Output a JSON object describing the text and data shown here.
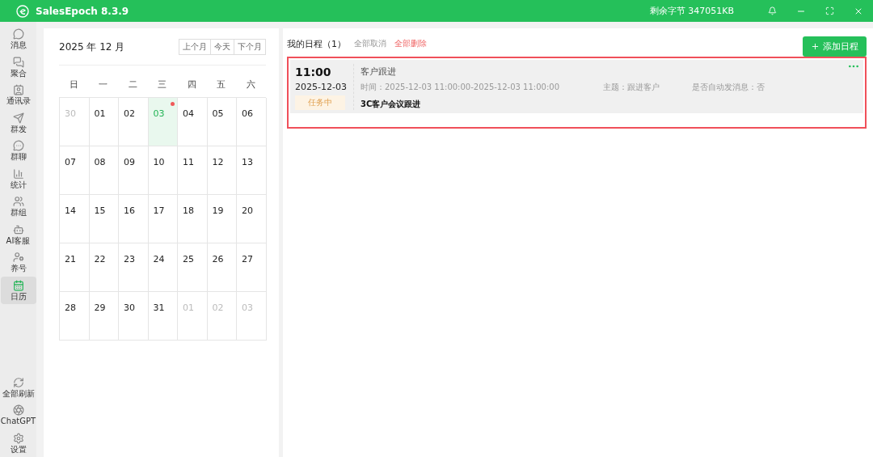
{
  "window": {
    "title": "SalesEpoch 8.3.9",
    "storage": "剩余字节 347051KB"
  },
  "sidebar": {
    "items": [
      {
        "label": "消息",
        "selected": false
      },
      {
        "label": "聚合",
        "selected": false
      },
      {
        "label": "通讯录",
        "selected": false
      },
      {
        "label": "群发",
        "selected": false
      },
      {
        "label": "群聊",
        "selected": false
      },
      {
        "label": "统计",
        "selected": false
      },
      {
        "label": "群组",
        "selected": false
      },
      {
        "label": "AI客服",
        "selected": false
      },
      {
        "label": "养号",
        "selected": false
      },
      {
        "label": "日历",
        "selected": true
      }
    ],
    "bottom_items": [
      {
        "label": "全部刷新"
      },
      {
        "label": "ChatGPT"
      },
      {
        "label": "设置"
      }
    ]
  },
  "calendar": {
    "month_label": "2025 年 12 月",
    "nav_buttons": [
      "上个月",
      "今天",
      "下个月"
    ],
    "weekdays": [
      "日",
      "一",
      "二",
      "三",
      "四",
      "五",
      "六"
    ],
    "weeks": [
      [
        {
          "day": "30",
          "muted": true,
          "selected": false,
          "has_event": false
        },
        {
          "day": "01",
          "muted": false,
          "selected": false,
          "has_event": false
        },
        {
          "day": "02",
          "muted": false,
          "selected": false,
          "has_event": false
        },
        {
          "day": "03",
          "muted": false,
          "selected": true,
          "has_event": true
        },
        {
          "day": "04",
          "muted": false,
          "selected": false,
          "has_event": false
        },
        {
          "day": "05",
          "muted": false,
          "selected": false,
          "has_event": false
        },
        {
          "day": "06",
          "muted": false,
          "selected": false,
          "has_event": false
        }
      ],
      [
        {
          "day": "07",
          "muted": false,
          "selected": false,
          "has_event": false
        },
        {
          "day": "08",
          "muted": false,
          "selected": false,
          "has_event": false
        },
        {
          "day": "09",
          "muted": false,
          "selected": false,
          "has_event": false
        },
        {
          "day": "10",
          "muted": false,
          "selected": false,
          "has_event": false
        },
        {
          "day": "11",
          "muted": false,
          "selected": false,
          "has_event": false
        },
        {
          "day": "12",
          "muted": false,
          "selected": false,
          "has_event": false
        },
        {
          "day": "13",
          "muted": false,
          "selected": false,
          "has_event": false
        }
      ],
      [
        {
          "day": "14",
          "muted": false,
          "selected": false,
          "has_event": false
        },
        {
          "day": "15",
          "muted": false,
          "selected": false,
          "has_event": false
        },
        {
          "day": "16",
          "muted": false,
          "selected": false,
          "has_event": false
        },
        {
          "day": "17",
          "muted": false,
          "selected": false,
          "has_event": false
        },
        {
          "day": "18",
          "muted": false,
          "selected": false,
          "has_event": false
        },
        {
          "day": "19",
          "muted": false,
          "selected": false,
          "has_event": false
        },
        {
          "day": "20",
          "muted": false,
          "selected": false,
          "has_event": false
        }
      ],
      [
        {
          "day": "21",
          "muted": false,
          "selected": false,
          "has_event": false
        },
        {
          "day": "22",
          "muted": false,
          "selected": false,
          "has_event": false
        },
        {
          "day": "23",
          "muted": false,
          "selected": false,
          "has_event": false
        },
        {
          "day": "24",
          "muted": false,
          "selected": false,
          "has_event": false
        },
        {
          "day": "25",
          "muted": false,
          "selected": false,
          "has_event": false
        },
        {
          "day": "26",
          "muted": false,
          "selected": false,
          "has_event": false
        },
        {
          "day": "27",
          "muted": false,
          "selected": false,
          "has_event": false
        }
      ],
      [
        {
          "day": "28",
          "muted": false,
          "selected": false,
          "has_event": false
        },
        {
          "day": "29",
          "muted": false,
          "selected": false,
          "has_event": false
        },
        {
          "day": "30",
          "muted": false,
          "selected": false,
          "has_event": false
        },
        {
          "day": "31",
          "muted": false,
          "selected": false,
          "has_event": false
        },
        {
          "day": "01",
          "muted": true,
          "selected": false,
          "has_event": false
        },
        {
          "day": "02",
          "muted": true,
          "selected": false,
          "has_event": false
        },
        {
          "day": "03",
          "muted": true,
          "selected": false,
          "has_event": false
        }
      ]
    ]
  },
  "schedule": {
    "title": "我的日程（1）",
    "cancel_all": "全部取消",
    "delete_all": "全部删除",
    "add_button": "添加日程",
    "events": [
      {
        "time": "11:00",
        "date": "2025-12-03",
        "status": "任务中",
        "title": "客户跟进",
        "period": "时间：2025-12-03 11:00:00-2025-12-03 11:00:00",
        "subject": "主题：跟进客户",
        "auto_message": "是否自动发消息：否",
        "content": "3C客户会议跟进",
        "highlighted": true
      }
    ]
  }
}
